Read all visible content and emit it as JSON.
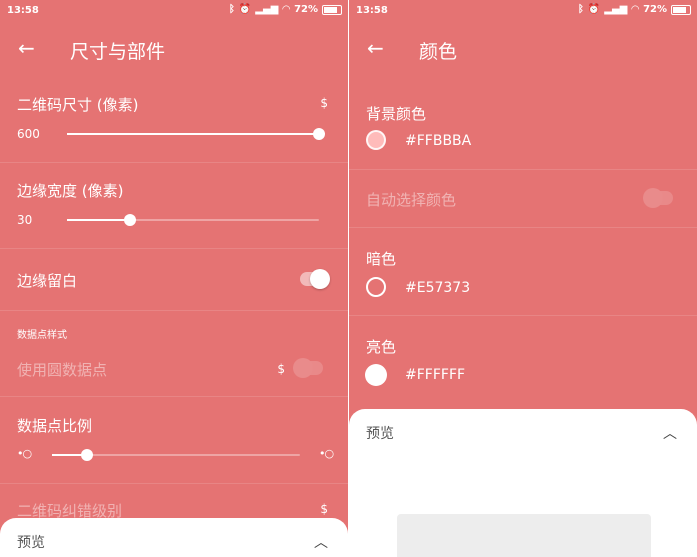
{
  "status": {
    "time": "13:58",
    "battery": "72%"
  },
  "left": {
    "title": "尺寸与部件",
    "qr_size": {
      "label": "二维码尺寸 (像素)",
      "value": "600",
      "level": 1.0
    },
    "margin_width": {
      "label": "边缘宽度 (像素)",
      "value": "30",
      "level": 0.25
    },
    "margin_blank": {
      "label": "边缘留白",
      "enabled": true
    },
    "dot_style_section": "数据点样式",
    "round_dots": {
      "label": "使用圆数据点",
      "enabled": false
    },
    "dot_ratio": {
      "label": "数据点比例",
      "level": 0.15
    },
    "error_level": {
      "label": "二维码纠错级别"
    },
    "premium_marker": "$",
    "preview": {
      "label": "预览"
    }
  },
  "right": {
    "title": "颜色",
    "background": {
      "label": "背景颜色",
      "hex": "#FFBBBA",
      "color": "#FFBBBA"
    },
    "auto_color": {
      "label": "自动选择颜色",
      "enabled": false
    },
    "dark": {
      "label": "暗色",
      "hex": "#E57373",
      "color": "#E57373"
    },
    "light": {
      "label": "亮色",
      "hex": "#FFFFFF",
      "color": "#FFFFFF"
    },
    "preview": {
      "label": "预览"
    }
  },
  "colors": {
    "accent": "#E57373",
    "white": "#FFFFFF"
  },
  "icons": [
    "back-arrow-icon",
    "bluetooth-icon",
    "alarm-icon",
    "signal-icon",
    "wifi-icon",
    "battery-icon",
    "chevron-up-icon"
  ]
}
